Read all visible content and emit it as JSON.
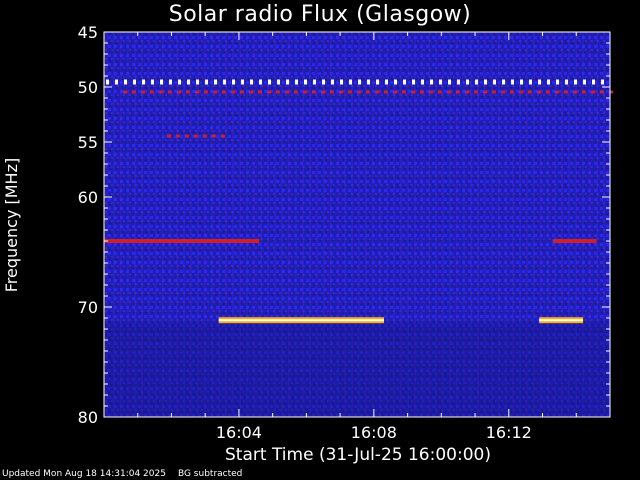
{
  "chart_data": {
    "type": "heatmap",
    "title": "Solar radio Flux (Glasgow)",
    "xlabel": "Start Time (31-Jul-25 16:00:00)",
    "ylabel": "Frequency [MHz]",
    "x_unit": "minutes after 16:00",
    "xlim": [
      0,
      15
    ],
    "ylim": [
      45,
      80
    ],
    "y_inverted": true,
    "y_ticks": [
      45,
      50,
      55,
      60,
      70,
      80
    ],
    "x_ticks": [
      {
        "value": 4,
        "label": "16:04"
      },
      {
        "value": 8,
        "label": "16:08"
      },
      {
        "value": 12,
        "label": "16:12"
      }
    ],
    "colormap": [
      "#1a1a8c",
      "#2b2bff",
      "#7a2bd0",
      "#d02020",
      "#ffb000",
      "#ffffff"
    ],
    "features": [
      {
        "kind": "dotted-line",
        "freq": 49.5,
        "t_start": 0.0,
        "t_end": 15.0,
        "intensity": "high"
      },
      {
        "kind": "dotted-line",
        "freq": 50.5,
        "t_start": 0.5,
        "t_end": 15.0,
        "intensity": "medium"
      },
      {
        "kind": "dotted-line",
        "freq": 54.5,
        "t_start": 1.8,
        "t_end": 3.5,
        "intensity": "medium"
      },
      {
        "kind": "band",
        "freq": 64.0,
        "t_start": 0.0,
        "t_end": 4.6,
        "intensity": "medium"
      },
      {
        "kind": "band",
        "freq": 64.0,
        "t_start": 13.3,
        "t_end": 14.6,
        "intensity": "medium"
      },
      {
        "kind": "band",
        "freq": 71.2,
        "t_start": 3.4,
        "t_end": 8.3,
        "intensity": "high"
      },
      {
        "kind": "band",
        "freq": 71.2,
        "t_start": 12.9,
        "t_end": 14.2,
        "intensity": "high"
      }
    ]
  },
  "footer": {
    "updated": "Updated Mon Aug 18 14:31:04 2025",
    "note": "BG subtracted"
  },
  "colors": {
    "background": "#000000",
    "axes": "#ffffff"
  }
}
